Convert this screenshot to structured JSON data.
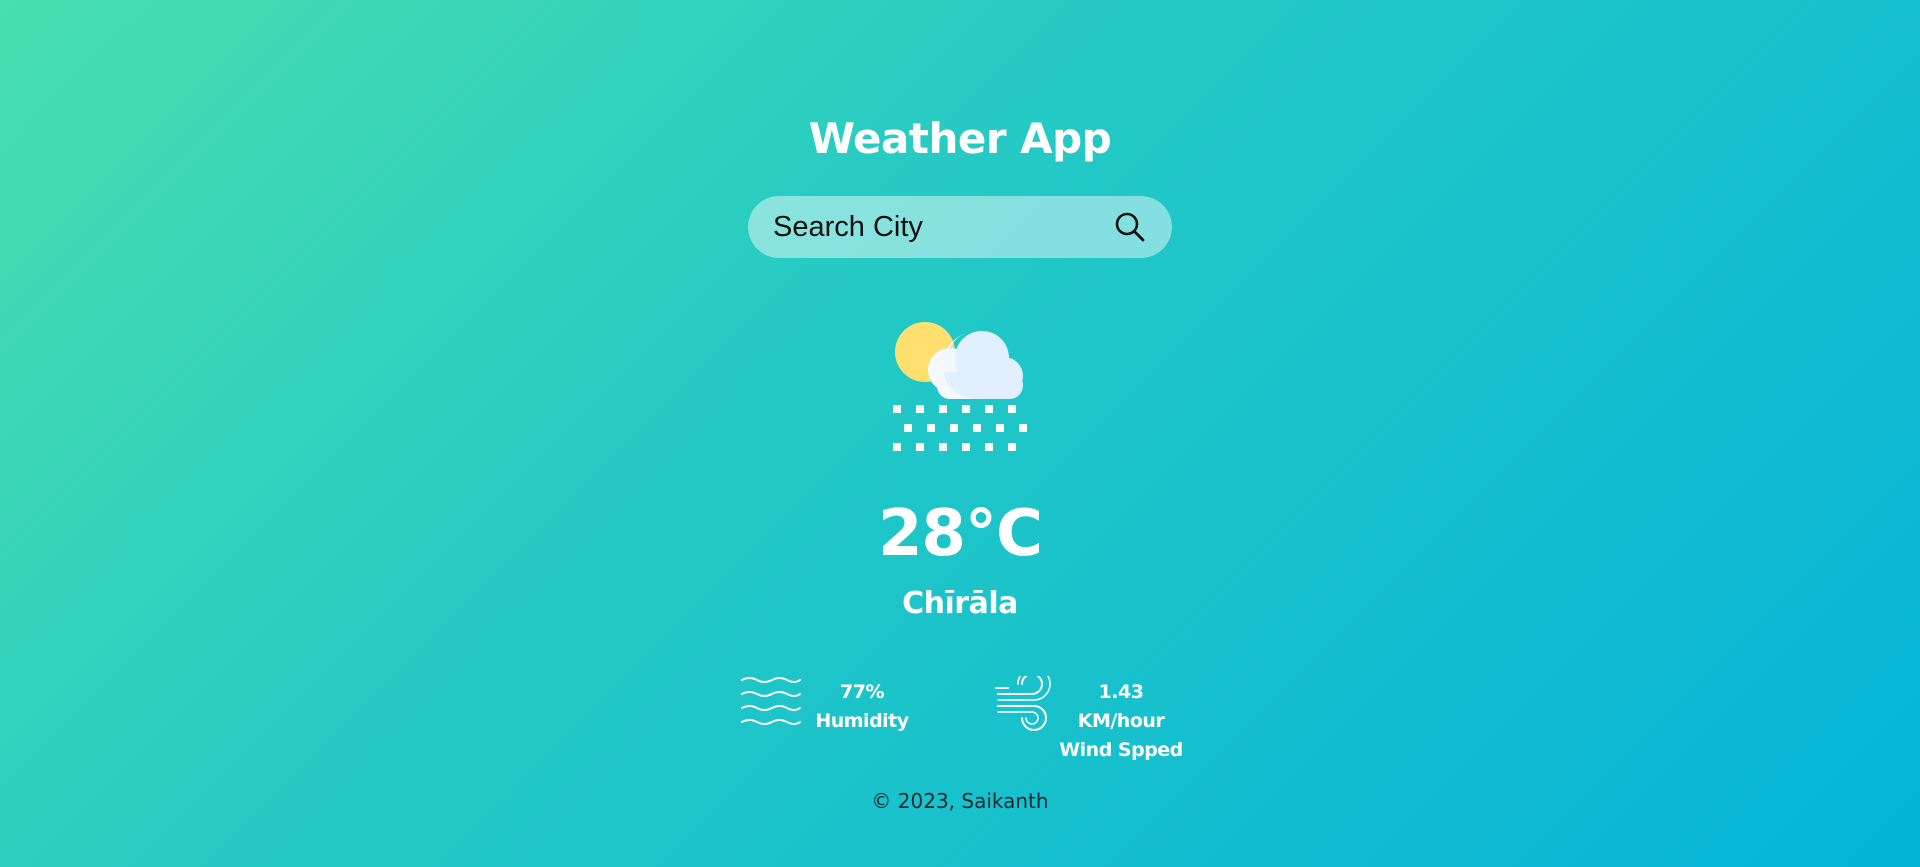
{
  "app": {
    "title": "Weather App"
  },
  "search": {
    "placeholder": "Search City",
    "value": "",
    "icon": "search-icon"
  },
  "weather": {
    "icon": "cloud-sun-snow-icon",
    "temperature": "28°C",
    "city": "Chīrāla"
  },
  "details": {
    "humidity": {
      "icon": "humidity-waves-icon",
      "value": "77%",
      "label": "Humidity"
    },
    "wind": {
      "icon": "wind-icon",
      "value": "1.43 KM/hour",
      "label": "Wind Spped"
    }
  },
  "footer": {
    "text": "© 2023, Saikanth"
  },
  "colors": {
    "gradient_start": "#48dfae",
    "gradient_end": "#04b4d8",
    "text": "#ffffff",
    "footer_text": "#0e2a33",
    "sun": "#ffe06e",
    "cloud": "#eef6ff"
  }
}
